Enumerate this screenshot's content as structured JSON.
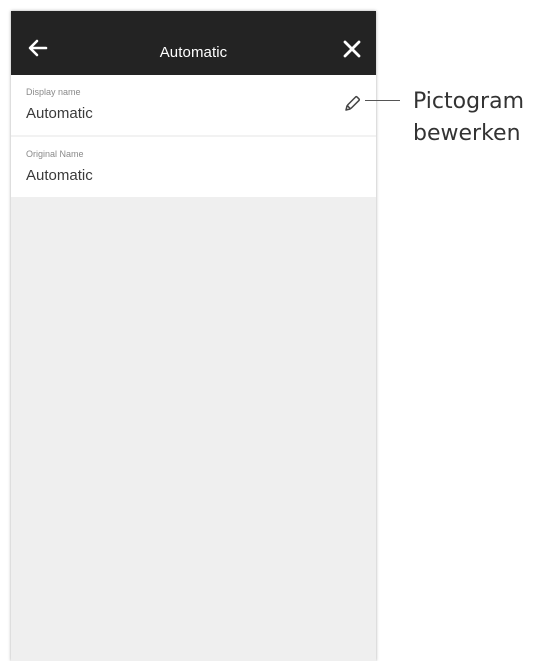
{
  "header": {
    "title": "Automatic",
    "back_icon": "arrow-left-icon",
    "close_icon": "close-icon"
  },
  "fields": [
    {
      "label": "Display name",
      "value": "Automatic",
      "editable": true,
      "edit_icon": "pencil-icon"
    },
    {
      "label": "Original Name",
      "value": "Automatic",
      "editable": false
    }
  ],
  "callout": {
    "line1": "Pictogram",
    "line2": "bewerken"
  },
  "colors": {
    "header_bg": "#232323",
    "page_bg": "#efefef",
    "card_bg": "#ffffff"
  }
}
